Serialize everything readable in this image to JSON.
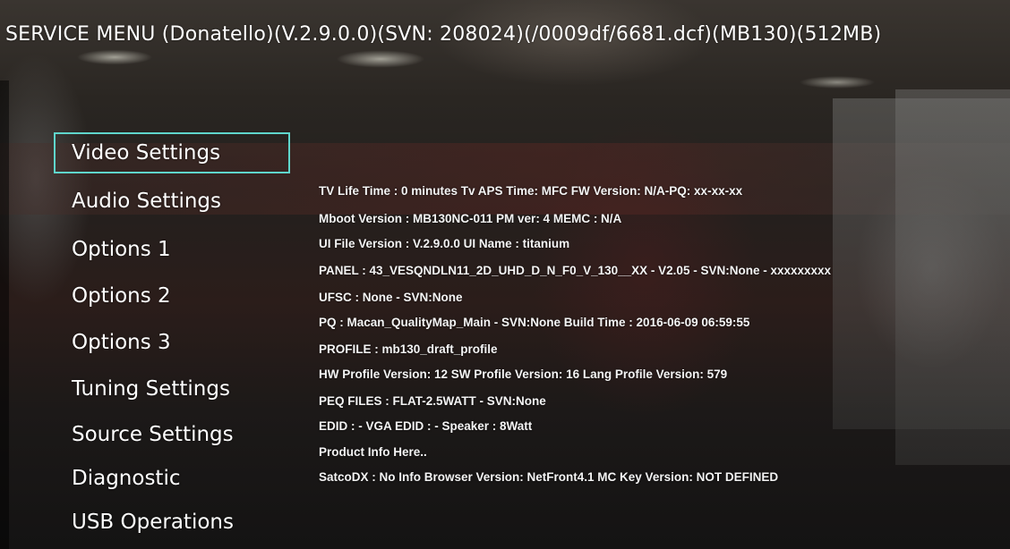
{
  "header": {
    "title": "SERVICE MENU (Donatello)(V.2.9.0.0)(SVN: 208024)(/0009df/6681.dcf)(MB130)(512MB)"
  },
  "menu": {
    "items": [
      {
        "label": "Video Settings",
        "selected": true
      },
      {
        "label": "Audio Settings",
        "selected": false
      },
      {
        "label": "Options 1",
        "selected": false
      },
      {
        "label": "Options 2",
        "selected": false
      },
      {
        "label": "Options 3",
        "selected": false
      },
      {
        "label": "Tuning Settings",
        "selected": false
      },
      {
        "label": "Source Settings",
        "selected": false
      },
      {
        "label": "Diagnostic",
        "selected": false
      },
      {
        "label": "USB Operations",
        "selected": false
      }
    ]
  },
  "info": {
    "lines": [
      "TV Life Time : 0 minutes  Tv APS Time:  MFC FW Version: N/A-PQ: xx-xx-xx",
      "Mboot Version : MB130NC-011 PM ver: 4 MEMC : N/A",
      "UI File Version : V.2.9.0.0  UI Name : titanium",
      "PANEL : 43_VESQNDLN11_2D_UHD_D_N_F0_V_130__XX - V2.05 - SVN:None - xxxxxxxxx",
      "UFSC : None - SVN:None",
      "PQ : Macan_QualityMap_Main - SVN:None  Build Time : 2016-06-09 06:59:55",
      "PROFILE : mb130_draft_profile",
      "HW Profile Version: 12  SW Profile Version: 16  Lang Profile Version: 579",
      "PEQ FILES : FLAT-2.5WATT - SVN:None",
      "EDID : -    VGA EDID : -    Speaker : 8Watt",
      "Product Info Here..",
      "SatcoDX : No Info  Browser Version: NetFront4.1   MC Key Version: NOT DEFINED"
    ]
  },
  "colors": {
    "selection_border": "#5fd6cc",
    "text": "#ffffff"
  }
}
